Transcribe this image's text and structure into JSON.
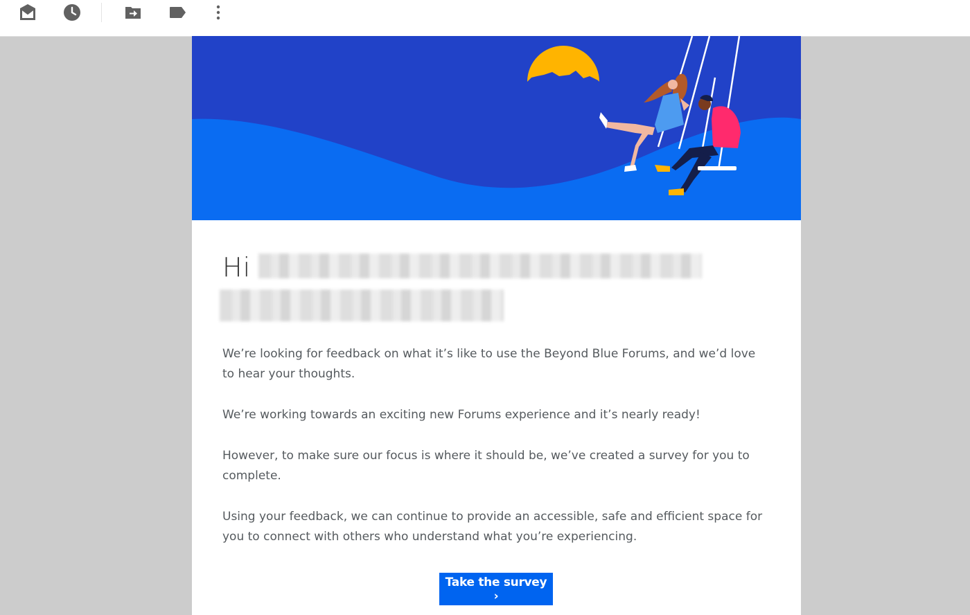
{
  "toolbar": {
    "buttons": [
      {
        "name": "mark-unread-icon"
      },
      {
        "name": "snooze-clock-icon"
      },
      {
        "name": "move-to-icon"
      },
      {
        "name": "label-tag-icon"
      },
      {
        "name": "more-vertical-icon"
      }
    ],
    "icon_color": "#616161"
  },
  "email": {
    "hero": {
      "sky_color": "#2142c8",
      "wave_color": "#0a6cf2",
      "sun_color": "#ffb400"
    },
    "greeting": "Hi",
    "paragraphs": [
      "We’re looking for feedback on what it’s like to use the Beyond Blue Forums, and we’d love to hear your thoughts.",
      "We’re working towards an exciting new Forums experience and it’s nearly ready!",
      "However, to make sure our focus is where it should be, we’ve created a survey for you to complete.",
      "Using your feedback, we can continue to provide an accessible, safe and efficient space for you to connect with others who understand what you’re experiencing."
    ],
    "cta_label": "Take the survey ›",
    "cta_color": "#0064f0"
  }
}
